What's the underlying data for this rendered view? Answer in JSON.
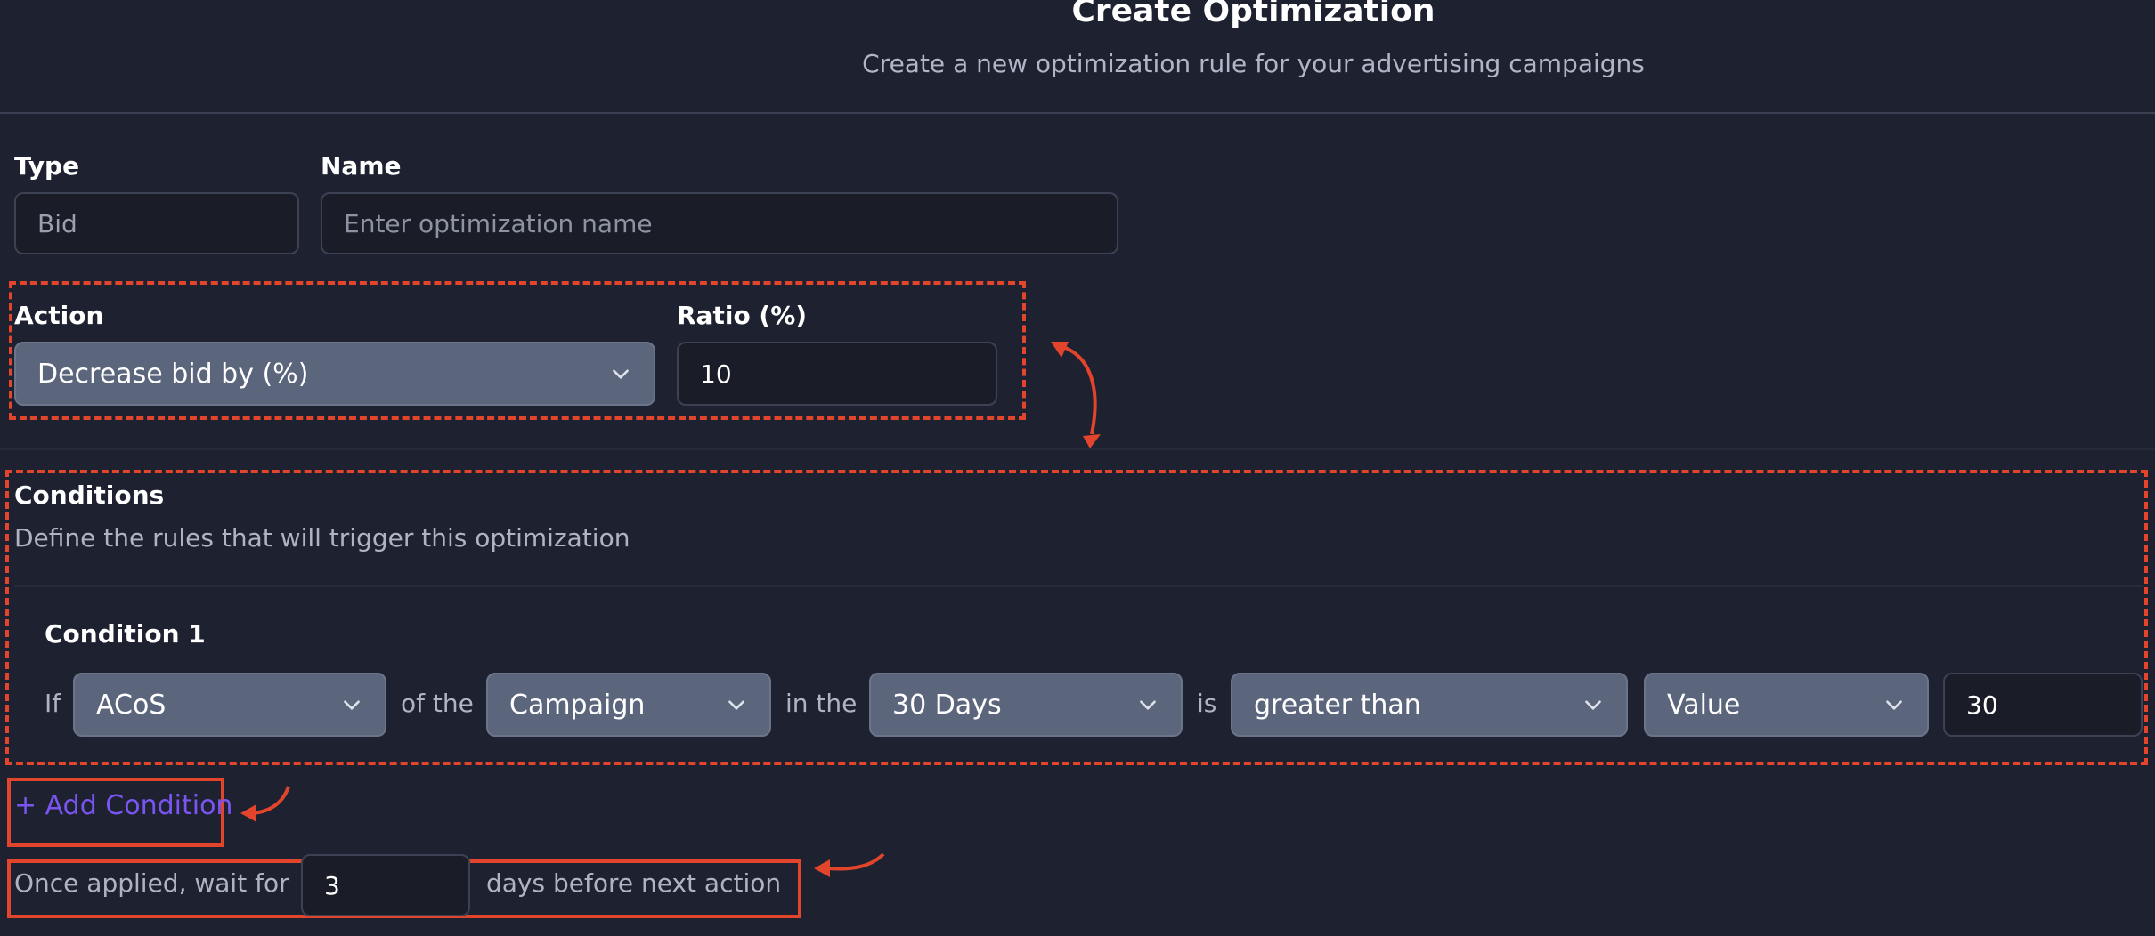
{
  "header": {
    "title": "Create Optimization",
    "subtitle": "Create a new optimization rule for your advertising campaigns"
  },
  "form": {
    "type": {
      "label": "Type",
      "value": "Bid"
    },
    "name": {
      "label": "Name",
      "placeholder": "Enter optimization name",
      "value": ""
    },
    "action": {
      "label": "Action",
      "selected": "Decrease bid by (%)"
    },
    "ratio": {
      "label": "Ratio (%)",
      "value": "10"
    }
  },
  "conditions": {
    "title": "Conditions",
    "description": "Define the rules that will trigger this optimization",
    "items": [
      {
        "heading": "Condition 1",
        "if_label": "If",
        "metric": "ACoS",
        "of_the_label": "of the",
        "level": "Campaign",
        "in_the_label": "in the",
        "period": "30 Days",
        "is_label": "is",
        "operator": "greater than",
        "compare_type": "Value",
        "value": "30"
      }
    ],
    "add_condition_label": "+ Add Condition"
  },
  "wait": {
    "prefix": "Once applied, wait for",
    "days": "3",
    "suffix": "days before next action"
  },
  "colors": {
    "background": "#1e2230",
    "select_bg": "#5b657c",
    "input_bg": "#1a1d27",
    "accent_link": "#7a55f2",
    "annotation": "#e2452b"
  }
}
